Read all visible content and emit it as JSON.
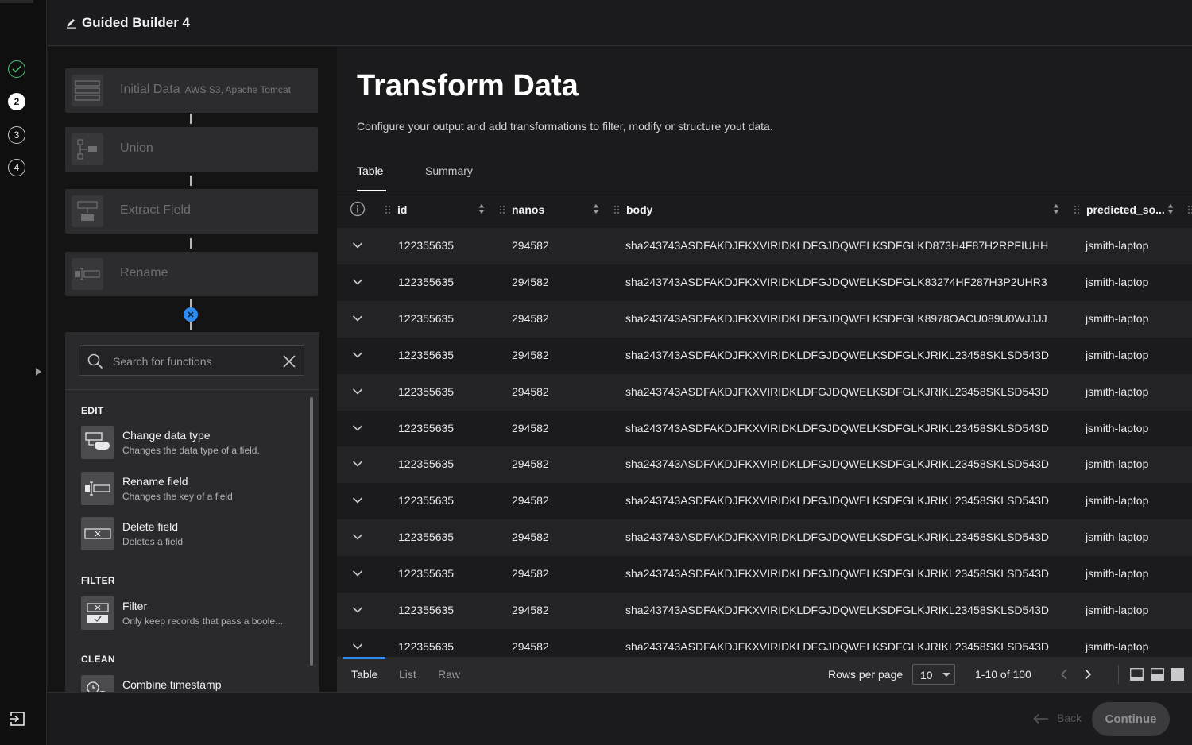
{
  "app": {
    "title": "Guided Builder 4"
  },
  "steps": [
    {
      "label": "",
      "state": "done"
    },
    {
      "label": "2",
      "state": "active"
    },
    {
      "label": "3",
      "state": "pending"
    },
    {
      "label": "4",
      "state": "pending"
    }
  ],
  "pipeline": {
    "nodes": [
      {
        "label": "Initial Data",
        "sub": "AWS S3, Apache Tomcat",
        "icon": "stacked-rows-icon"
      },
      {
        "label": "Union",
        "sub": "",
        "icon": "union-icon"
      },
      {
        "label": "Extract Field",
        "sub": "",
        "icon": "extract-field-icon"
      },
      {
        "label": "Rename",
        "sub": "",
        "icon": "rename-icon"
      }
    ],
    "add_symbol": "✕"
  },
  "functions": {
    "search_placeholder": "Search for functions",
    "sections": [
      {
        "title": "EDIT",
        "items": [
          {
            "title": "Change data type",
            "desc": "Changes the data type of a field.",
            "icon": "change-type-icon"
          },
          {
            "title": "Rename field",
            "desc": "Changes the key of a field",
            "icon": "rename-field-icon"
          },
          {
            "title": "Delete field",
            "desc": "Deletes a field",
            "icon": "delete-field-icon"
          }
        ]
      },
      {
        "title": "FILTER",
        "items": [
          {
            "title": "Filter",
            "desc": "Only keep records that pass a boole...",
            "icon": "filter-icon"
          }
        ]
      },
      {
        "title": "CLEAN",
        "items": [
          {
            "title": "Combine timestamp",
            "desc": "",
            "icon": "combine-timestamp-icon"
          }
        ]
      }
    ]
  },
  "main": {
    "title": "Transform Data",
    "subtitle": "Configure your output and add transformations to filter, modify or structure yout data.",
    "tabs": [
      "Table",
      "Summary"
    ],
    "active_tab": "Table"
  },
  "table": {
    "columns": [
      "id",
      "nanos",
      "body",
      "predicted_so..."
    ],
    "rows": [
      [
        "122355635",
        "294582",
        "sha243743ASDFAKDJFKXVIRIDKLDFGJDQWELKSDFGLKD873H4F87H2RPFIUHH",
        "jsmith-laptop"
      ],
      [
        "122355635",
        "294582",
        "sha243743ASDFAKDJFKXVIRIDKLDFGJDQWELKSDFGLK83274HF287H3P2UHR3",
        "jsmith-laptop"
      ],
      [
        "122355635",
        "294582",
        "sha243743ASDFAKDJFKXVIRIDKLDFGJDQWELKSDFGLK8978OACU089U0WJJJJ",
        "jsmith-laptop"
      ],
      [
        "122355635",
        "294582",
        "sha243743ASDFAKDJFKXVIRIDKLDFGJDQWELKSDFGLKJRIKL23458SKLSD543D",
        "jsmith-laptop"
      ],
      [
        "122355635",
        "294582",
        "sha243743ASDFAKDJFKXVIRIDKLDFGJDQWELKSDFGLKJRIKL23458SKLSD543D",
        "jsmith-laptop"
      ],
      [
        "122355635",
        "294582",
        "sha243743ASDFAKDJFKXVIRIDKLDFGJDQWELKSDFGLKJRIKL23458SKLSD543D",
        "jsmith-laptop"
      ],
      [
        "122355635",
        "294582",
        "sha243743ASDFAKDJFKXVIRIDKLDFGJDQWELKSDFGLKJRIKL23458SKLSD543D",
        "jsmith-laptop"
      ],
      [
        "122355635",
        "294582",
        "sha243743ASDFAKDJFKXVIRIDKLDFGJDQWELKSDFGLKJRIKL23458SKLSD543D",
        "jsmith-laptop"
      ],
      [
        "122355635",
        "294582",
        "sha243743ASDFAKDJFKXVIRIDKLDFGJDQWELKSDFGLKJRIKL23458SKLSD543D",
        "jsmith-laptop"
      ],
      [
        "122355635",
        "294582",
        "sha243743ASDFAKDJFKXVIRIDKLDFGJDQWELKSDFGLKJRIKL23458SKLSD543D",
        "jsmith-laptop"
      ],
      [
        "122355635",
        "294582",
        "sha243743ASDFAKDJFKXVIRIDKLDFGJDQWELKSDFGLKJRIKL23458SKLSD543D",
        "jsmith-laptop"
      ],
      [
        "122355635",
        "294582",
        "sha243743ASDFAKDJFKXVIRIDKLDFGJDQWELKSDFGLKJRIKL23458SKLSD543D",
        "jsmith-laptop"
      ]
    ]
  },
  "footer": {
    "view_tabs": [
      "Table",
      "List",
      "Raw"
    ],
    "active_view": "Table",
    "rows_per_page_label": "Rows per page",
    "rows_per_page": "10",
    "range": "1-10 of 100"
  },
  "actions": {
    "back": "Back",
    "continue": "Continue"
  },
  "colors": {
    "accent": "#2d8cf0",
    "success": "#4ec27a"
  }
}
